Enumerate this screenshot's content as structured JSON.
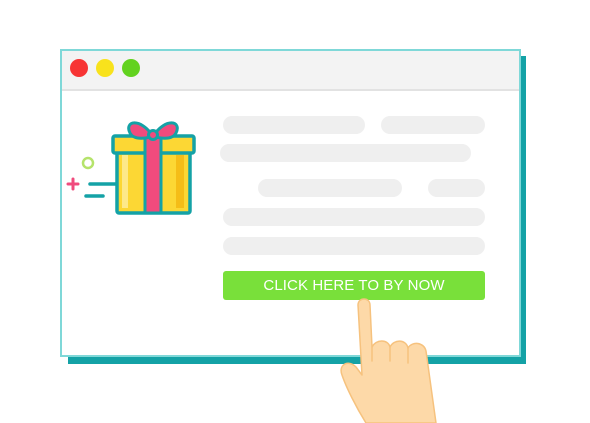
{
  "cta": {
    "label": "CLICK HERE TO BY NOW"
  },
  "colors": {
    "window_shadow": "#14a2a6",
    "titlebar": "#f3f3f3",
    "close_dot": "#f73434",
    "minimize_dot": "#f8e21c",
    "maximize_dot": "#62d21f",
    "placeholder_bar": "#efefef",
    "cta_background": "#79e03a",
    "cta_text": "#ffffff"
  },
  "icons": [
    "gift-icon",
    "hand-pointer-icon",
    "sparkle-circle-icon",
    "plus-icon"
  ]
}
